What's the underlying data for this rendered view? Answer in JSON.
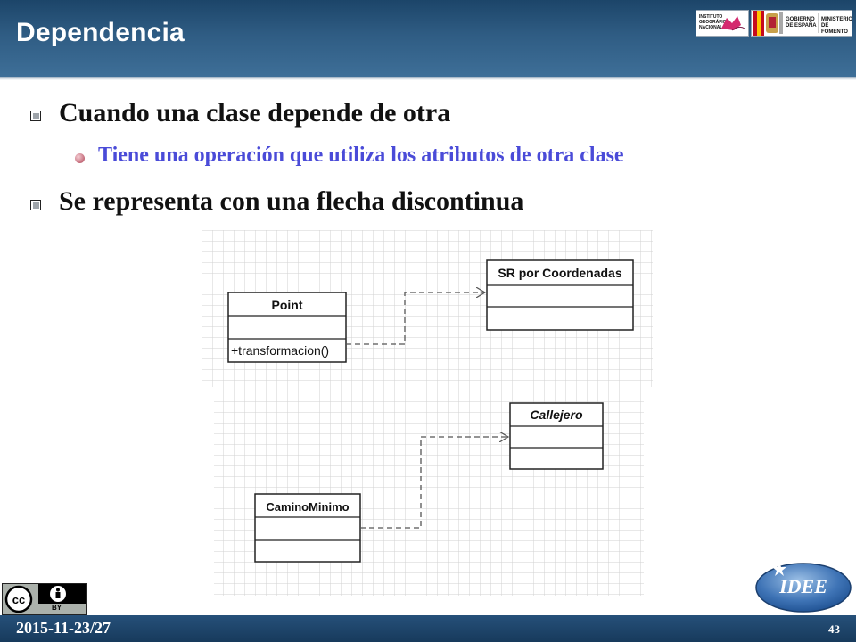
{
  "slide": {
    "title": "Dependencia",
    "bullets": [
      {
        "text": "Cuando una clase depende de otra",
        "sub": [
          "Tiene una operación que utiliza los atributos de otra clase"
        ]
      },
      {
        "text": "Se representa con una flecha discontinua"
      }
    ]
  },
  "logos": {
    "ign": "INSTITUTO GEOGRÁFICO NACIONAL",
    "gobierno": "GOBIERNO DE ESPAÑA",
    "ministerio": "MINISTERIO DE FOMENTO",
    "idee": "IDEE",
    "license_by": "BY"
  },
  "diagram": {
    "example1": {
      "source_class": {
        "name": "Point",
        "operations": [
          "+transformacion()"
        ]
      },
      "target_class": {
        "name": "SR por Coordenadas"
      }
    },
    "example2": {
      "source_class": {
        "name": "CaminoMinimo"
      },
      "target_class": {
        "name": "Callejero"
      }
    }
  },
  "footer": {
    "date": "2015-11-23/27",
    "page": "43"
  },
  "colors": {
    "header": "#2f5c83",
    "subbullet_text": "#4a4bd8",
    "dependency_arrow": "#555555"
  }
}
